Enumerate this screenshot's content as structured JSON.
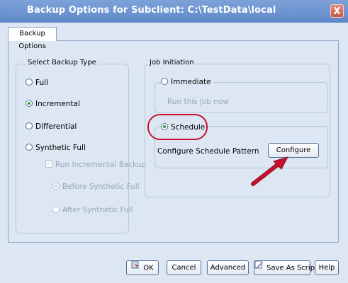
{
  "window": {
    "title": "Backup Options for Subclient: C:\\TestData\\local",
    "close_glyph": "X"
  },
  "tabs": [
    {
      "label": "Backup Options",
      "selected": true
    }
  ],
  "backup_type": {
    "label": "Select Backup Type",
    "options": [
      {
        "label": "Full",
        "selected": false
      },
      {
        "label": "Incremental",
        "selected": true
      },
      {
        "label": "Differential",
        "selected": false
      },
      {
        "label": "Synthetic Full",
        "selected": false
      }
    ],
    "run_incremental": {
      "label": "Run Incremental Backup",
      "checked": true,
      "enabled": false
    },
    "before_synthetic": {
      "label": "Before Synthetic Full",
      "selected": true,
      "enabled": false
    },
    "after_synthetic": {
      "label": "After Synthetic Full",
      "selected": false,
      "enabled": false
    }
  },
  "job_initiation": {
    "label": "Job Initiation",
    "immediate": {
      "label": "Immediate",
      "selected": false,
      "description": "Run this job now"
    },
    "schedule": {
      "label": "Schedule",
      "selected": true,
      "pattern_label": "Configure Schedule Pattern",
      "configure_label": "Configure"
    }
  },
  "buttons": {
    "ok": "OK",
    "cancel": "Cancel",
    "advanced": "Advanced",
    "save_as_script": "Save As Script",
    "help": "Help"
  },
  "annotations": {
    "highlight_color": "#c8102e",
    "arrow_color": "#c8102e"
  }
}
